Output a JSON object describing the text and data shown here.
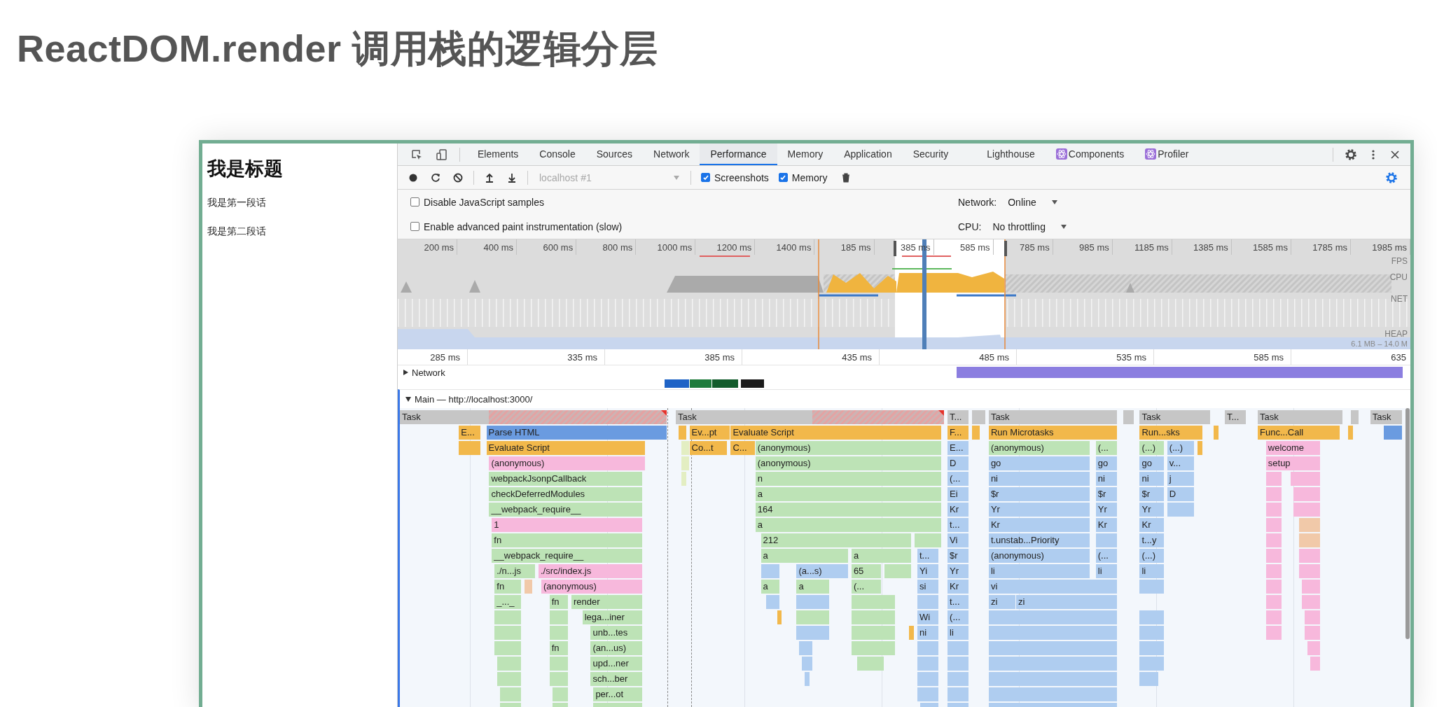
{
  "slide_title": "ReactDOM.render 调用栈的逻辑分层",
  "page_preview": {
    "heading": "我是标题",
    "paragraphs": [
      "我是第一段话",
      "我是第二段话"
    ]
  },
  "devtools": {
    "tabs": [
      {
        "label": "Elements",
        "kind": "panel",
        "selected": false
      },
      {
        "label": "Console",
        "kind": "panel",
        "selected": false
      },
      {
        "label": "Sources",
        "kind": "panel",
        "selected": false
      },
      {
        "label": "Network",
        "kind": "panel",
        "selected": false
      },
      {
        "label": "Performance",
        "kind": "panel",
        "selected": true
      },
      {
        "label": "Memory",
        "kind": "panel",
        "selected": false
      },
      {
        "label": "Application",
        "kind": "panel",
        "selected": false
      },
      {
        "label": "Security",
        "kind": "panel",
        "selected": false
      },
      {
        "label": "Lighthouse",
        "kind": "panel",
        "selected": false
      },
      {
        "label": "Components",
        "kind": "extension",
        "selected": false
      },
      {
        "label": "Profiler",
        "kind": "extension",
        "selected": false
      }
    ],
    "toolbar": {
      "target": {
        "value": "localhost #1",
        "disabled": true
      },
      "checkboxes": [
        {
          "label": "Screenshots",
          "checked": true
        },
        {
          "label": "Memory",
          "checked": true
        }
      ]
    },
    "settings": {
      "options": [
        {
          "label": "Disable JavaScript samples",
          "checked": false
        },
        {
          "label": "Enable advanced paint instrumentation (slow)",
          "checked": false
        }
      ],
      "throttles": [
        {
          "label": "Network:",
          "value": "Online"
        },
        {
          "label": "CPU:",
          "value": "No throttling"
        }
      ]
    },
    "overview": {
      "ticks": [
        "200 ms",
        "400 ms",
        "600 ms",
        "800 ms",
        "1000 ms",
        "1200 ms",
        "1400 ms",
        "185 ms",
        "385 ms",
        "585 ms",
        "785 ms",
        "985 ms",
        "1185 ms",
        "1385 ms",
        "1585 ms",
        "1785 ms",
        "1985 ms"
      ],
      "tracks": [
        "FPS",
        "CPU",
        "NET",
        "HEAP"
      ],
      "heap_range": "6.1 MB – 14.0 M"
    },
    "ruler": [
      "285 ms",
      "335 ms",
      "385 ms",
      "435 ms",
      "485 ms",
      "535 ms",
      "585 ms",
      "635"
    ],
    "network_track": {
      "label": "Network",
      "expanded": false
    },
    "timing_markers": [
      {
        "color": "#1f63c6"
      },
      {
        "color": "#1e7b3c"
      },
      {
        "color": "#135c2c"
      },
      {
        "color": "#1b1b1b"
      }
    ],
    "main_track": {
      "label": "Main — http://localhost:3000/",
      "expanded": true
    },
    "flame_rows": [
      [
        {
          "color": "#c6c6c6",
          "label": "Task",
          "long": true
        },
        {
          "color": "#c6c6c6",
          "label": "Task",
          "long": true
        },
        {
          "color": "#c6c6c6",
          "label": "T...",
          "long": false
        },
        {
          "color": "#c6c6c6",
          "long": false
        },
        {
          "color": "#c6c6c6",
          "label": "Task",
          "long": false
        },
        {
          "color": "#c6c6c6",
          "long": false
        },
        {
          "color": "#c6c6c6",
          "label": "Task",
          "long": false
        },
        {
          "color": "#c6c6c6",
          "label": "T...",
          "long": false
        },
        {
          "color": "#c6c6c6",
          "label": "Task",
          "long": false
        },
        {
          "color": "#c6c6c6",
          "long": false
        },
        {
          "color": "#c6c6c6",
          "label": "Task",
          "long": false
        }
      ],
      [
        {
          "color": "#f2b84b",
          "label": "E..."
        },
        {
          "color": "#6a9be0",
          "label": "Parse HTML"
        },
        {
          "color": "#f2b84b"
        },
        {
          "color": "#f2b84b",
          "label": "Ev...pt"
        },
        {
          "color": "#f2b84b",
          "label": "Evaluate Script"
        },
        {
          "color": "#f2b84b",
          "label": "F..."
        },
        {
          "color": "#f2b84b"
        },
        {
          "color": "#f2b84b",
          "label": "Run Microtasks"
        },
        {
          "color": "#f2b84b",
          "label": "Run...sks"
        },
        {
          "color": "#f2b84b"
        },
        {
          "color": "#f2b84b",
          "label": "Func...Call"
        },
        {
          "color": "#f2b84b"
        },
        {
          "color": "#6a9be0"
        }
      ],
      [
        {
          "color": "#f2b84b"
        },
        {
          "color": "#f2b84b",
          "label": "Evaluate Script"
        },
        {
          "color": "#e3eec2"
        },
        {
          "color": "#f2b84b",
          "label": "Co...t"
        },
        {
          "color": "#f2b84b",
          "label": "C..."
        },
        {
          "color": "#bde3b6",
          "label": "(anonymous)"
        },
        {
          "color": "#afcdf0",
          "label": "E..."
        },
        {
          "color": "#bde3b6",
          "label": "(anonymous)"
        },
        {
          "color": "#bde3b6",
          "label": "(..."
        },
        {
          "color": "#bde3b6",
          "label": "(...)"
        },
        {
          "color": "#afcdf0",
          "label": "(...)"
        },
        {
          "color": "#f2b84b"
        },
        {
          "color": "#f7b8dc",
          "label": "welcome"
        }
      ],
      [
        {
          "color": "#f7b8dc",
          "label": "(anonymous)"
        },
        {
          "color": "#e3eec2"
        },
        {
          "color": "#bde3b6",
          "label": "(anonymous)"
        },
        {
          "color": "#afcdf0",
          "label": "D"
        },
        {
          "color": "#afcdf0",
          "label": "go"
        },
        {
          "color": "#afcdf0",
          "label": "go"
        },
        {
          "color": "#afcdf0",
          "label": "go"
        },
        {
          "color": "#afcdf0",
          "label": "v..."
        },
        {
          "color": "#f7b8dc",
          "label": "setup"
        }
      ],
      [
        {
          "color": "#bde3b6",
          "label": "webpackJsonpCallback"
        },
        {
          "color": "#e3eec2"
        },
        {
          "color": "#bde3b6",
          "label": "n"
        },
        {
          "color": "#afcdf0",
          "label": "(..."
        },
        {
          "color": "#afcdf0",
          "label": "ni"
        },
        {
          "color": "#afcdf0",
          "label": "ni"
        },
        {
          "color": "#afcdf0",
          "label": "ni"
        },
        {
          "color": "#afcdf0",
          "label": "j"
        },
        {
          "color": "#f7b8dc"
        },
        {
          "color": "#f7b8dc"
        }
      ],
      [
        {
          "color": "#bde3b6",
          "label": "checkDeferredModules"
        },
        {
          "color": "#bde3b6",
          "label": "a"
        },
        {
          "color": "#afcdf0",
          "label": "Ei"
        },
        {
          "color": "#afcdf0",
          "label": "$r"
        },
        {
          "color": "#afcdf0",
          "label": "$r"
        },
        {
          "color": "#afcdf0",
          "label": "$r"
        },
        {
          "color": "#afcdf0",
          "label": "D"
        },
        {
          "color": "#f7b8dc"
        },
        {
          "color": "#f7b8dc"
        }
      ],
      [
        {
          "color": "#bde3b6",
          "label": "__webpack_require__"
        },
        {
          "color": "#bde3b6",
          "label": "164"
        },
        {
          "color": "#afcdf0",
          "label": "Kr"
        },
        {
          "color": "#afcdf0",
          "label": "Yr"
        },
        {
          "color": "#afcdf0",
          "label": "Yr"
        },
        {
          "color": "#afcdf0",
          "label": "Yr"
        },
        {
          "color": "#afcdf0"
        },
        {
          "color": "#f7b8dc"
        },
        {
          "color": "#f7b8dc"
        }
      ],
      [
        {
          "color": "#f7b8dc",
          "label": "1"
        },
        {
          "color": "#bde3b6",
          "label": "a"
        },
        {
          "color": "#afcdf0",
          "label": "t..."
        },
        {
          "color": "#afcdf0",
          "label": "Kr"
        },
        {
          "color": "#afcdf0",
          "label": "Kr"
        },
        {
          "color": "#afcdf0",
          "label": "Kr"
        },
        {
          "color": "#f7b8dc"
        },
        {
          "color": "#f1c9a9"
        }
      ],
      [
        {
          "color": "#bde3b6",
          "label": "fn"
        },
        {
          "color": "#bde3b6",
          "label": "212"
        },
        {
          "color": "#bde3b6"
        },
        {
          "color": "#afcdf0",
          "label": "Vi"
        },
        {
          "color": "#afcdf0",
          "label": "t.unstab...Priority"
        },
        {
          "color": "#afcdf0"
        },
        {
          "color": "#afcdf0",
          "label": "t...y"
        },
        {
          "color": "#f7b8dc"
        },
        {
          "color": "#f1c9a9"
        }
      ],
      [
        {
          "color": "#bde3b6",
          "label": "__webpack_require__"
        },
        {
          "color": "#bde3b6",
          "label": "a"
        },
        {
          "color": "#bde3b6",
          "label": "a"
        },
        {
          "color": "#afcdf0",
          "label": "t..."
        },
        {
          "color": "#afcdf0",
          "label": "$r"
        },
        {
          "color": "#afcdf0",
          "label": "(anonymous)"
        },
        {
          "color": "#afcdf0",
          "label": "(..."
        },
        {
          "color": "#afcdf0",
          "label": "(...)"
        },
        {
          "color": "#f7b8dc"
        },
        {
          "color": "#f7b8dc"
        }
      ],
      [
        {
          "color": "#bde3b6",
          "label": "./n...js"
        },
        {
          "color": "#f7b8dc",
          "label": "./src/index.js"
        },
        {
          "color": "#afcdf0"
        },
        {
          "color": "#afcdf0",
          "label": "(a...s)"
        },
        {
          "color": "#bde3b6",
          "label": "65"
        },
        {
          "color": "#bde3b6"
        },
        {
          "color": "#afcdf0",
          "label": "Yi"
        },
        {
          "color": "#afcdf0",
          "label": "Yr"
        },
        {
          "color": "#afcdf0",
          "label": "li"
        },
        {
          "color": "#afcdf0",
          "label": "li"
        },
        {
          "color": "#afcdf0",
          "label": "li"
        },
        {
          "color": "#f7b8dc"
        },
        {
          "color": "#f7b8dc"
        }
      ],
      [
        {
          "color": "#bde3b6",
          "label": "fn"
        },
        {
          "color": "#f1c9a9"
        },
        {
          "color": "#f7b8dc",
          "label": "(anonymous)"
        },
        {
          "color": "#bde3b6",
          "label": "a"
        },
        {
          "color": "#bde3b6",
          "label": "a"
        },
        {
          "color": "#bde3b6",
          "label": "(..."
        },
        {
          "color": "#afcdf0",
          "label": "si"
        },
        {
          "color": "#afcdf0",
          "label": "Kr"
        },
        {
          "color": "#afcdf0",
          "label": "vi"
        },
        {
          "color": "#afcdf0"
        },
        {
          "color": "#f7b8dc"
        },
        {
          "color": "#f7b8dc"
        }
      ],
      [
        {
          "color": "#bde3b6",
          "label": "_..._"
        },
        {
          "color": "#bde3b6",
          "label": "fn"
        },
        {
          "color": "#bde3b6",
          "label": "render"
        },
        {
          "color": "#afcdf0"
        },
        {
          "color": "#afcdf0"
        },
        {
          "color": "#bde3b6"
        },
        {
          "color": "#afcdf0"
        },
        {
          "color": "#afcdf0",
          "label": "t..."
        },
        {
          "color": "#afcdf0",
          "label": "zi"
        },
        {
          "color": "#afcdf0",
          "label": "zi"
        },
        {
          "color": "#f7b8dc"
        },
        {
          "color": "#f7b8dc"
        }
      ],
      [
        {
          "color": "#bde3b6"
        },
        {
          "color": "#bde3b6"
        },
        {
          "color": "#bde3b6",
          "label": "lega...iner"
        },
        {
          "color": "#f2b84b"
        },
        {
          "color": "#bde3b6"
        },
        {
          "color": "#bde3b6"
        },
        {
          "color": "#afcdf0",
          "label": "Wi"
        },
        {
          "color": "#afcdf0",
          "label": "(..."
        },
        {
          "color": "#afcdf0"
        },
        {
          "color": "#afcdf0"
        },
        {
          "color": "#f7b8dc"
        },
        {
          "color": "#f7b8dc"
        }
      ],
      [
        {
          "color": "#bde3b6"
        },
        {
          "color": "#bde3b6"
        },
        {
          "color": "#bde3b6",
          "label": "unb...tes"
        },
        {
          "color": "#afcdf0"
        },
        {
          "color": "#bde3b6"
        },
        {
          "color": "#f2b84b"
        },
        {
          "color": "#afcdf0",
          "label": "ni"
        },
        {
          "color": "#afcdf0",
          "label": "li"
        },
        {
          "color": "#afcdf0"
        },
        {
          "color": "#afcdf0"
        },
        {
          "color": "#f7b8dc"
        },
        {
          "color": "#f7b8dc"
        }
      ],
      [
        {
          "color": "#bde3b6"
        },
        {
          "color": "#bde3b6",
          "label": "fn"
        },
        {
          "color": "#bde3b6",
          "label": "(an...us)"
        },
        {
          "color": "#afcdf0"
        },
        {
          "color": "#bde3b6"
        },
        {
          "color": "#afcdf0"
        },
        {
          "color": "#afcdf0"
        },
        {
          "color": "#afcdf0"
        },
        {
          "color": "#afcdf0"
        },
        {
          "color": "#f7b8dc"
        }
      ],
      [
        {
          "color": "#bde3b6"
        },
        {
          "color": "#bde3b6"
        },
        {
          "color": "#bde3b6",
          "label": "upd...ner"
        },
        {
          "color": "#afcdf0"
        },
        {
          "color": "#bde3b6"
        },
        {
          "color": "#afcdf0"
        },
        {
          "color": "#afcdf0"
        },
        {
          "color": "#afcdf0"
        },
        {
          "color": "#afcdf0"
        },
        {
          "color": "#f7b8dc"
        }
      ],
      [
        {
          "color": "#bde3b6"
        },
        {
          "color": "#bde3b6"
        },
        {
          "color": "#bde3b6",
          "label": "sch...ber"
        },
        {
          "color": "#afcdf0"
        },
        {
          "color": "#afcdf0"
        },
        {
          "color": "#afcdf0"
        },
        {
          "color": "#afcdf0"
        },
        {
          "color": "#afcdf0"
        }
      ],
      [
        {
          "color": "#bde3b6"
        },
        {
          "color": "#bde3b6"
        },
        {
          "color": "#bde3b6",
          "label": "per...ot"
        },
        {
          "color": "#afcdf0"
        },
        {
          "color": "#afcdf0"
        },
        {
          "color": "#afcdf0"
        }
      ],
      [
        {
          "color": "#bde3b6"
        },
        {
          "color": "#bde3b6"
        },
        {
          "color": "#bde3b6"
        },
        {
          "color": "#afcdf0"
        },
        {
          "color": "#afcdf0"
        },
        {
          "color": "#afcdf0"
        }
      ]
    ]
  }
}
